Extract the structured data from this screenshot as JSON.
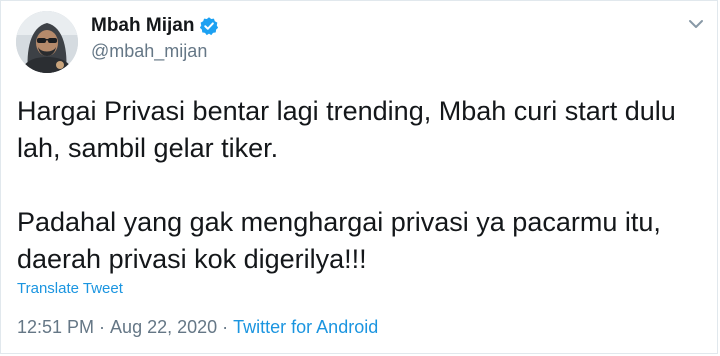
{
  "author": {
    "display_name": "Mbah Mijan",
    "handle": "@mbah_mijan",
    "verified": true,
    "avatar_icon": "profile-photo"
  },
  "menu": {
    "icon": "chevron-down-icon"
  },
  "tweet": {
    "paragraph_1_line_1": "Hargai Privasi bentar lagi trending, Mbah curi start dulu",
    "paragraph_1_line_2": "lah, sambil gelar tiker.",
    "paragraph_2_line_1": "Padahal yang gak menghargai privasi ya pacarmu itu,",
    "paragraph_2_line_2": "daerah privasi kok digerilya!!!"
  },
  "translate_label": "Translate Tweet",
  "meta": {
    "time": "12:51 PM",
    "date": "Aug 22, 2020",
    "separator": "·",
    "source": "Twitter for Android"
  },
  "colors": {
    "link": "#1b95e0",
    "text": "#14171a",
    "muted": "#657786",
    "verified": "#1da1f2"
  }
}
